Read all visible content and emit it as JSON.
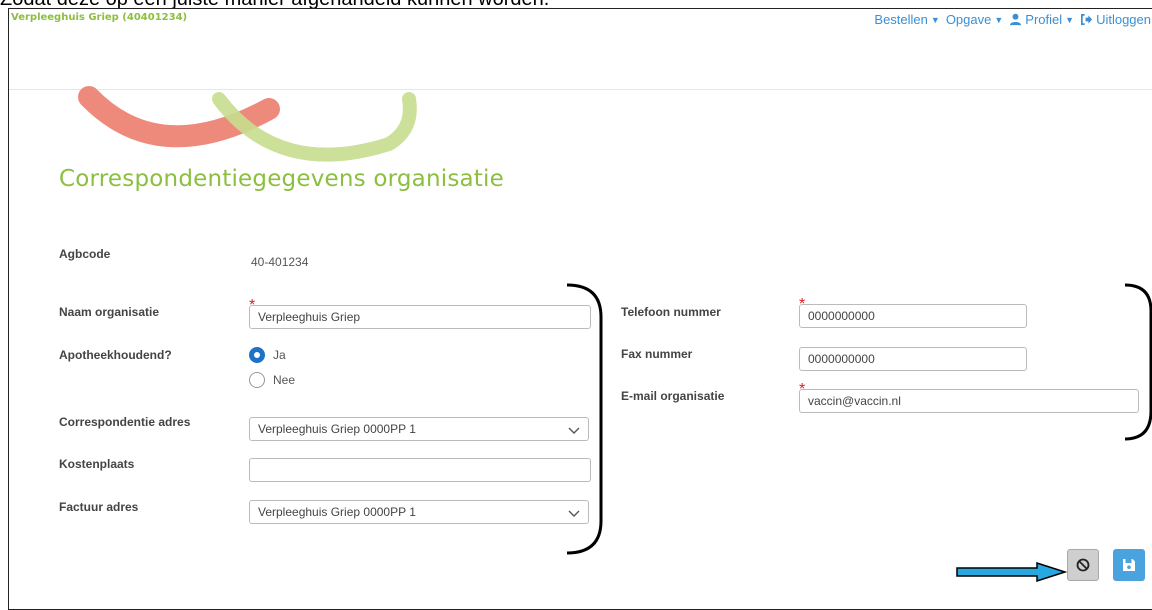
{
  "caption": "Zodat deze op een juiste manier afgehandeld kunnen worden.",
  "header": {
    "brand": "Verpleeghuis Griep (40401234)",
    "nav": [
      {
        "label": "Bestellen",
        "icon": "caret-down-icon"
      },
      {
        "label": "Opgave",
        "icon": "caret-down-icon"
      },
      {
        "label": "Profiel",
        "icon": "user-icon"
      },
      {
        "label": "Uitloggen",
        "icon": "sign-out-icon"
      }
    ]
  },
  "page": {
    "title": "Correspondentiegegevens organisatie"
  },
  "form": {
    "agbcode": {
      "label": "Agbcode",
      "value": "40-401234"
    },
    "naam": {
      "label": "Naam organisatie",
      "value": "Verpleeghuis Griep",
      "required_mark": "*"
    },
    "apotheek": {
      "label": "Apotheekhoudend?",
      "options": [
        "Ja",
        "Nee"
      ],
      "selected": "Ja"
    },
    "corr_adres": {
      "label": "Correspondentie adres",
      "value": "Verpleeghuis Griep 0000PP 1"
    },
    "kostenplaats": {
      "label": "Kostenplaats",
      "value": ""
    },
    "factuur_adres": {
      "label": "Factuur adres",
      "value": "Verpleeghuis Griep 0000PP 1"
    },
    "telefoon": {
      "label": "Telefoon nummer",
      "value": "0000000000",
      "required_mark": "*"
    },
    "fax": {
      "label": "Fax nummer",
      "value": "0000000000"
    },
    "email": {
      "label": "E-mail organisatie",
      "value": "vaccin@vaccin.nl",
      "required_mark": "*"
    }
  },
  "actions": {
    "cancel_icon": "ban-icon",
    "save_icon": "floppy-disk-icon"
  },
  "colors": {
    "brand_green": "#8cbf3f",
    "link_blue": "#3a8fd6",
    "radio_blue": "#1e73c8",
    "save_blue": "#4aa3df",
    "required_red": "#e02020",
    "annotation_arrow": "#29a8e0"
  }
}
